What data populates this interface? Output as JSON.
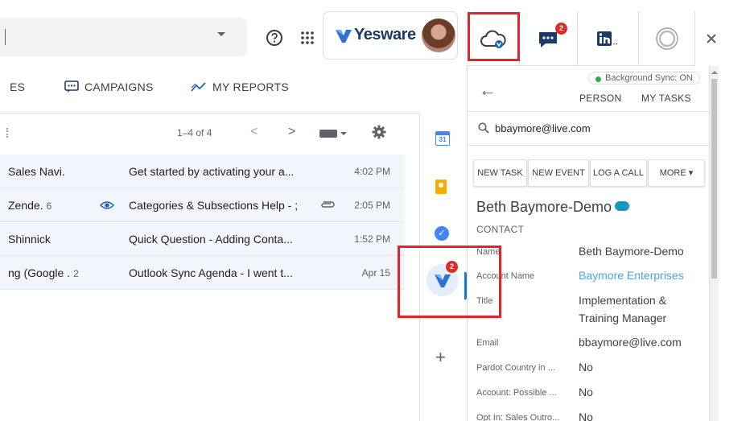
{
  "search": {
    "value": ""
  },
  "header": {
    "brand": "Yesware"
  },
  "side_tabs": {
    "chat_badge": "2"
  },
  "nav": {
    "partial": "ES",
    "campaigns": "CAMPAIGNS",
    "reports": "MY REPORTS"
  },
  "toolbar": {
    "pager": "1–4 of 4"
  },
  "emails": [
    {
      "sender": "Sales Navi.",
      "count": "",
      "subject": "Get started by activating your a...",
      "time": "4:02 PM"
    },
    {
      "sender": "Zende.",
      "count": "6",
      "subject": "Categories & Subsections Help - ;",
      "time": "2:05 PM"
    },
    {
      "sender": "Shinnick",
      "count": "",
      "subject": "Quick Question - Adding Conta...",
      "time": "1:52 PM"
    },
    {
      "sender": "ng (Google .",
      "count": "2",
      "subject": "Outlook Sync Agenda - I went t...",
      "time": "Apr 15"
    }
  ],
  "addons": {
    "calendar_day": "31",
    "yesware_badge": "2"
  },
  "panel": {
    "sync_status": "Background Sync: ON",
    "tabs": [
      "PERSON",
      "MY TASKS"
    ],
    "search_value": "bbaymore@live.com",
    "actions": [
      "NEW TASK",
      "NEW EVENT",
      "LOG A CALL",
      "MORE ▾"
    ],
    "contact_name": "Beth Baymore-Demo",
    "record_type": "CONTACT",
    "fields": [
      {
        "label": "Name",
        "value": "Beth Baymore-Demo"
      },
      {
        "label": "Account Name",
        "value": "Baymore Enterprises"
      },
      {
        "label": "Title",
        "value": "Implementation &"
      },
      {
        "label": "",
        "value": "Training Manager"
      },
      {
        "label": "Email",
        "value": "bbaymore@live.com"
      },
      {
        "label": "Pardot Country in ...",
        "value": "No"
      },
      {
        "label": "Account: Possible ...",
        "value": "No"
      },
      {
        "label": "Opt In: Sales Outro...",
        "value": "No"
      }
    ]
  },
  "colors": {
    "highlight_box": "#e3242b",
    "link": "#4fa3e0",
    "brand_navy": "#1b3a67",
    "sync_dot": "#34a853"
  }
}
